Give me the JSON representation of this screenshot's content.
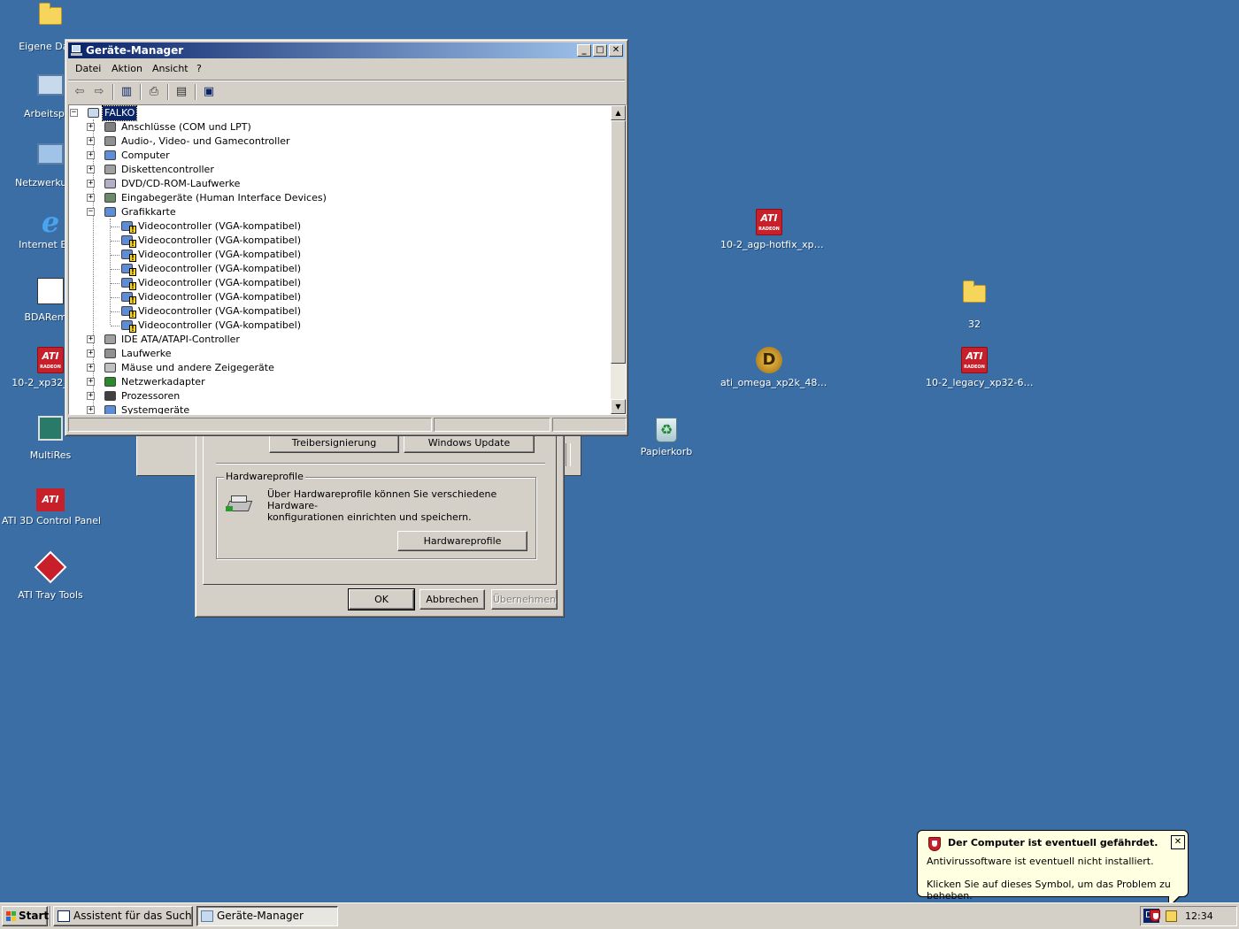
{
  "desktop": {
    "icons": [
      {
        "label": "Eigene Dat…"
      },
      {
        "label": "Arbeitspl…"
      },
      {
        "label": "Netzwerkum…"
      },
      {
        "label": "Internet Ex…"
      },
      {
        "label": "BDARem…"
      },
      {
        "label": "10-2_xp32_dc…"
      },
      {
        "label": "MultiRes"
      },
      {
        "label": "ATI 3D Control Panel"
      },
      {
        "label": "ATI Tray Tools"
      },
      {
        "label": "10-2_agp-hotfix_xp…"
      },
      {
        "label": "32"
      },
      {
        "label": "ati_omega_xp2k_48…"
      },
      {
        "label": "10-2_legacy_xp32-6…"
      },
      {
        "label": "Papierkorb"
      }
    ],
    "ati_logo_text": "ATI",
    "ati_logo_sub": "RADEON",
    "background_color": "#3a6ea5"
  },
  "sysprops": {
    "btn_treibersignierung": "Treibersignierung",
    "btn_windows_update": "Windows Update",
    "hw_group_title": "Hardwareprofile",
    "hw_text_line1": "Über Hardwareprofile können Sie verschiedene Hardware-",
    "hw_text_line2": "konfigurationen einrichten und speichern.",
    "btn_hardwareprofile": "Hardwareprofile",
    "btn_ok": "OK",
    "btn_abbrechen": "Abbrechen",
    "btn_uebernehmen": "Übernehmen"
  },
  "devmgr": {
    "title": "Geräte-Manager",
    "menu": [
      "Datei",
      "Aktion",
      "Ansicht",
      "?"
    ],
    "toolbar_icons": [
      "back-arrow-icon",
      "forward-arrow-icon",
      "show-hide-tree-icon",
      "print-icon",
      "properties-help-icon",
      "scan-hardware-icon"
    ],
    "root": "FALKO",
    "categories_top": [
      "Anschlüsse (COM und LPT)",
      "Audio-, Video- und Gamecontroller",
      "Computer",
      "Diskettencontroller",
      "DVD/CD-ROM-Laufwerke",
      "Eingabegeräte (Human Interface Devices)",
      "Grafikkarte"
    ],
    "video_devices": [
      "Videocontroller (VGA-kompatibel)",
      "Videocontroller (VGA-kompatibel)",
      "Videocontroller (VGA-kompatibel)",
      "Videocontroller (VGA-kompatibel)",
      "Videocontroller (VGA-kompatibel)",
      "Videocontroller (VGA-kompatibel)",
      "Videocontroller (VGA-kompatibel)",
      "Videocontroller (VGA-kompatibel)"
    ],
    "categories_bottom": [
      "IDE ATA/ATAPI-Controller",
      "Laufwerke",
      "Mäuse und andere Zeigegeräte",
      "Netzwerkadapter",
      "Prozessoren",
      "Systemgeräte"
    ]
  },
  "taskbar": {
    "start": "Start",
    "tasks": [
      "Assistent für das Suchen…",
      "Geräte-Manager"
    ],
    "lang": "DE",
    "clock": "12:34"
  },
  "balloon": {
    "title": "Der Computer ist eventuell gefährdet.",
    "line1": "Antivirussoftware ist eventuell nicht installiert.",
    "line2": "Klicken Sie auf dieses Symbol, um das Problem zu beheben."
  }
}
